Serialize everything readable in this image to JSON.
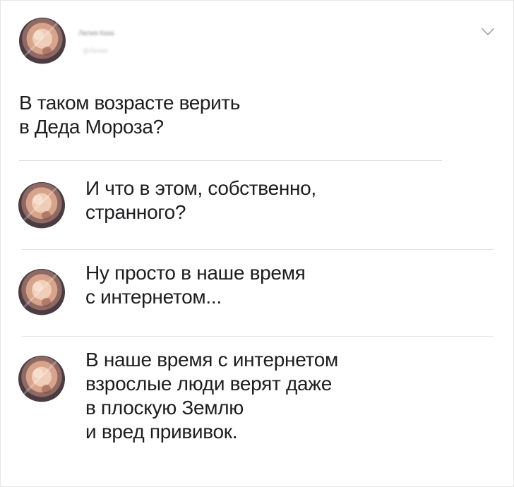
{
  "post": {
    "author_name": "Лилия Каза",
    "author_sub": "@Лилия"
  },
  "post_text": "В таком возрасте верить\nв Деда Мороза?",
  "replies": [
    {
      "text": "И что в этом, собственно,\nстранного?"
    },
    {
      "text": "Ну просто в наше время\nс интернетом..."
    },
    {
      "text": "В наше время с интернетом\nвзрослые люди верят даже\nв плоскую Землю\nи вред прививок."
    }
  ],
  "icons": {
    "chevron": "chevron-down-icon"
  },
  "colors": {
    "text": "#1d1d1f",
    "muted": "#9b9b9b",
    "divider": "#dfdfdf",
    "chevron": "#a9a9a9"
  }
}
